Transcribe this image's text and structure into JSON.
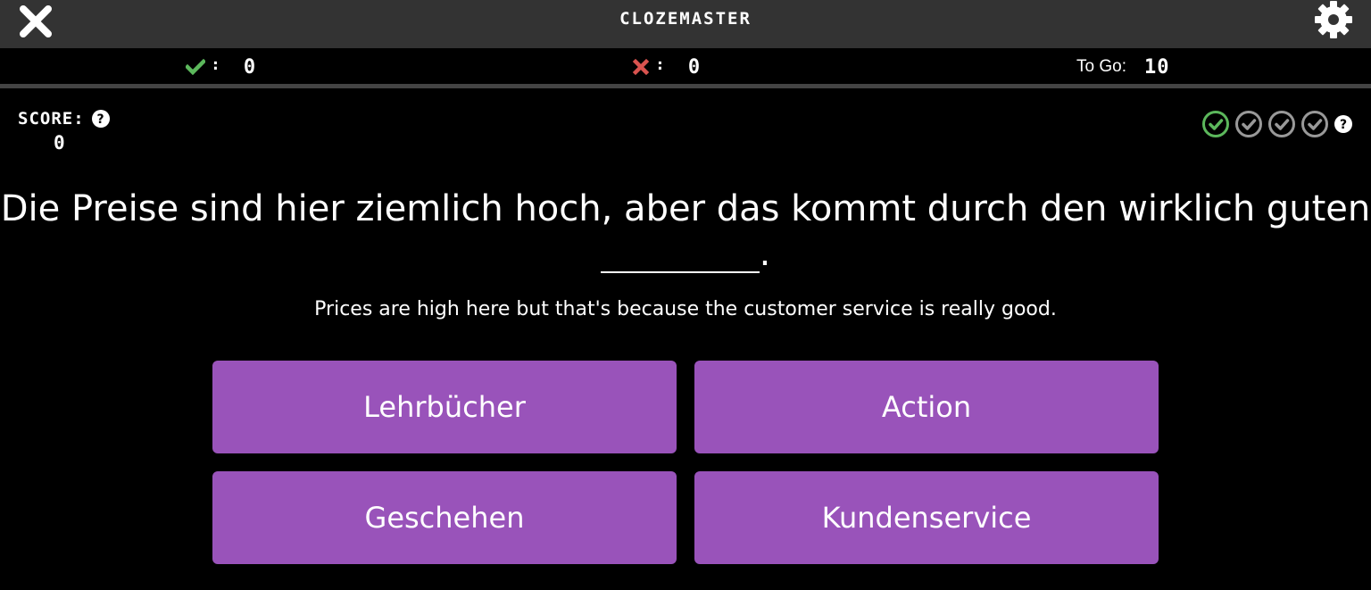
{
  "header": {
    "title": "CLOZEMASTER",
    "close_icon": "close-icon",
    "settings_icon": "gear-icon"
  },
  "stats": {
    "correct_count": "0",
    "incorrect_count": "0",
    "to_go_label": "To Go:",
    "to_go_count": "10",
    "colon": ":"
  },
  "score": {
    "label": "SCORE:",
    "value": "0"
  },
  "progress": {
    "completed": 1,
    "total": 4,
    "completed_color": "#5cb85c",
    "pending_color": "#999999"
  },
  "question": {
    "sentence_before": "Die Preise sind hier ziemlich hoch, aber das kommt durch den wirklich guten",
    "sentence_after": ".",
    "translation": "Prices are high here but that's because the customer service is really good."
  },
  "choices": [
    {
      "label": "Lehrbücher"
    },
    {
      "label": "Action"
    },
    {
      "label": "Geschehen"
    },
    {
      "label": "Kundenservice"
    }
  ],
  "colors": {
    "choice_bg": "#9953ba",
    "header_bg": "#333333",
    "correct": "#5cb85c",
    "incorrect": "#d9534f"
  }
}
